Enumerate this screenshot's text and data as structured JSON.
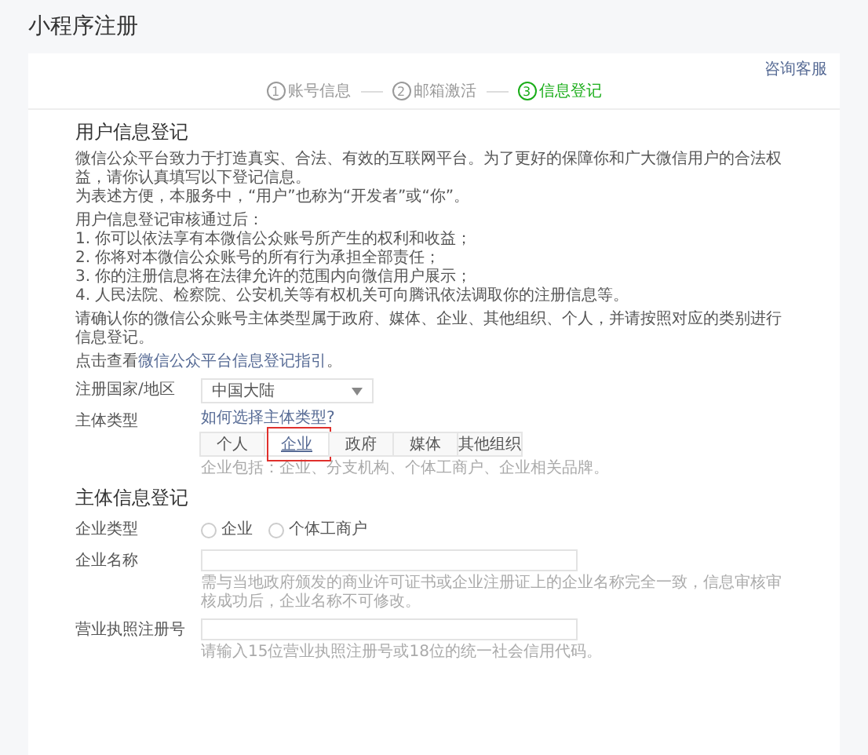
{
  "page_title": "小程序注册",
  "help_link": "咨询客服",
  "steps": [
    {
      "number": "1",
      "label": "账号信息",
      "selected": false
    },
    {
      "number": "2",
      "label": "邮箱激活",
      "selected": false
    },
    {
      "number": "3",
      "label": "信息登记",
      "selected": true
    }
  ],
  "user_section": {
    "title": "用户信息登记",
    "paragraphs": [
      [
        "微信公众平台致力于打造真实、合法、有效的互联网平台。为了更好的保障你和广大微信用户的合法权益，请你认真填写以下登记信息。",
        "为表述方便，本服务中，“用户”也称为“开发者”或“你”。"
      ],
      [
        "用户信息登记审核通过后：",
        "1. 你可以依法享有本微信公众账号所产生的权利和收益；",
        "2. 你将对本微信公众账号的所有行为承担全部责任；",
        "3. 你的注册信息将在法律允许的范围内向微信用户展示；",
        "4. 人民法院、检察院、公安机关等有权机关可向腾讯依法调取你的注册信息等。"
      ],
      [
        "请确认你的微信公众账号主体类型属于政府、媒体、企业、其他组织、个人，并请按照对应的类别进行信息登记。"
      ]
    ],
    "guide": {
      "prefix": "点击查看",
      "link": "微信公众平台信息登记指引",
      "suffix": "。"
    },
    "country": {
      "label": "注册国家/地区",
      "value": "中国大陆"
    },
    "entity_type": {
      "label": "主体类型",
      "help_link": "如何选择主体类型?",
      "options": [
        {
          "label": "个人",
          "selected": false
        },
        {
          "label": "企业",
          "selected": true
        },
        {
          "label": "政府",
          "selected": false
        },
        {
          "label": "媒体",
          "selected": false
        },
        {
          "label": "其他组织",
          "selected": false
        }
      ],
      "hint": "企业包括：企业、分支机构、个体工商户、企业相关品牌。",
      "highlighted": true
    }
  },
  "entity_section": {
    "title": "主体信息登记",
    "company_type": {
      "label": "企业类型",
      "options": [
        {
          "label": "企业",
          "selected": false
        },
        {
          "label": "个体工商户",
          "selected": false
        }
      ]
    },
    "fields": [
      {
        "label": "企业名称",
        "hint": "需与当地政府颁发的商业许可证书或企业注册证上的企业名称完全一致，信息审核审核成功后，企业名称不可修改。"
      },
      {
        "label": "营业执照注册号",
        "hint": "请输入15位营业执照注册号或18位的统一社会信用代码。"
      }
    ]
  }
}
